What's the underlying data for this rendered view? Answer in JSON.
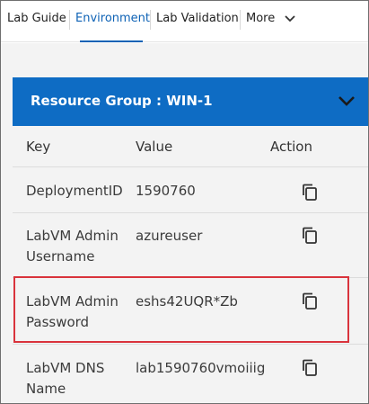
{
  "tabs": [
    {
      "label": "Lab Guide",
      "active": false
    },
    {
      "label": "Environment",
      "active": true
    },
    {
      "label": "Lab Validation",
      "active": false
    },
    {
      "label": "More",
      "active": false
    }
  ],
  "resource_group": {
    "title": "Resource Group : WIN-1",
    "expanded": true
  },
  "table": {
    "headers": {
      "key": "Key",
      "value": "Value",
      "action": "Action"
    },
    "rows": [
      {
        "key_line1": "DeploymentID",
        "key_line2": "",
        "value": "1590760"
      },
      {
        "key_line1": "LabVM Admin",
        "key_line2": "Username",
        "value": "azureuser"
      },
      {
        "key_line1": "LabVM Admin",
        "key_line2": "Password",
        "value": "eshs42UQR*Zb"
      },
      {
        "key_line1": "LabVM DNS",
        "key_line2": "Name",
        "value": "lab1590760vmoiiig"
      }
    ]
  },
  "colors": {
    "accent": "#0e6cc4",
    "active_tab": "#0e62b5",
    "highlight_border": "#d9333c",
    "panel_bg": "#f3f3f3"
  },
  "icons": {
    "more_chevron": "chevron-down-icon",
    "group_chevron": "chevron-down-icon",
    "copy": "copy-icon"
  }
}
